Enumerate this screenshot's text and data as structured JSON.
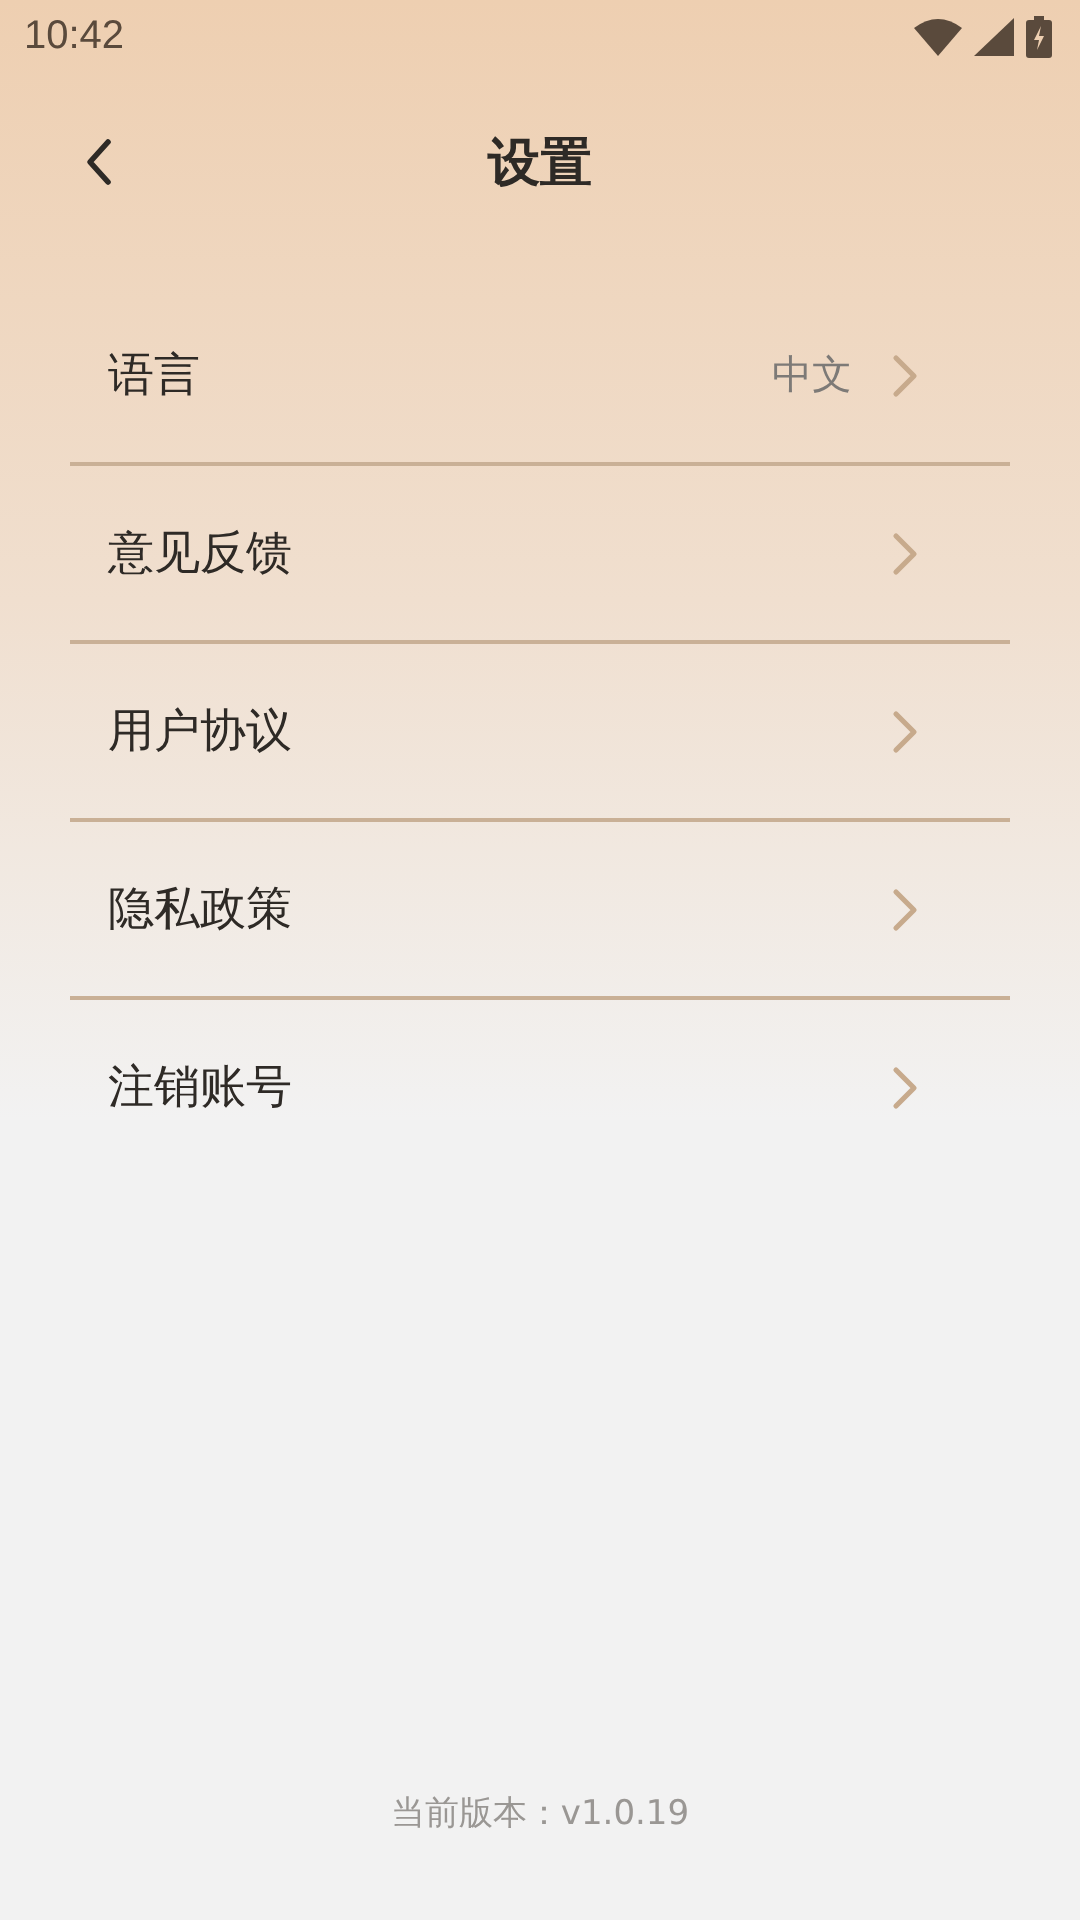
{
  "status_bar": {
    "time": "10:42"
  },
  "header": {
    "title": "设置"
  },
  "settings": [
    {
      "label": "语言",
      "value": "中文"
    },
    {
      "label": "意见反馈"
    },
    {
      "label": "用户协议"
    },
    {
      "label": "隐私政策"
    },
    {
      "label": "注销账号"
    }
  ],
  "footer": {
    "version": "当前版本：v1.0.19"
  }
}
